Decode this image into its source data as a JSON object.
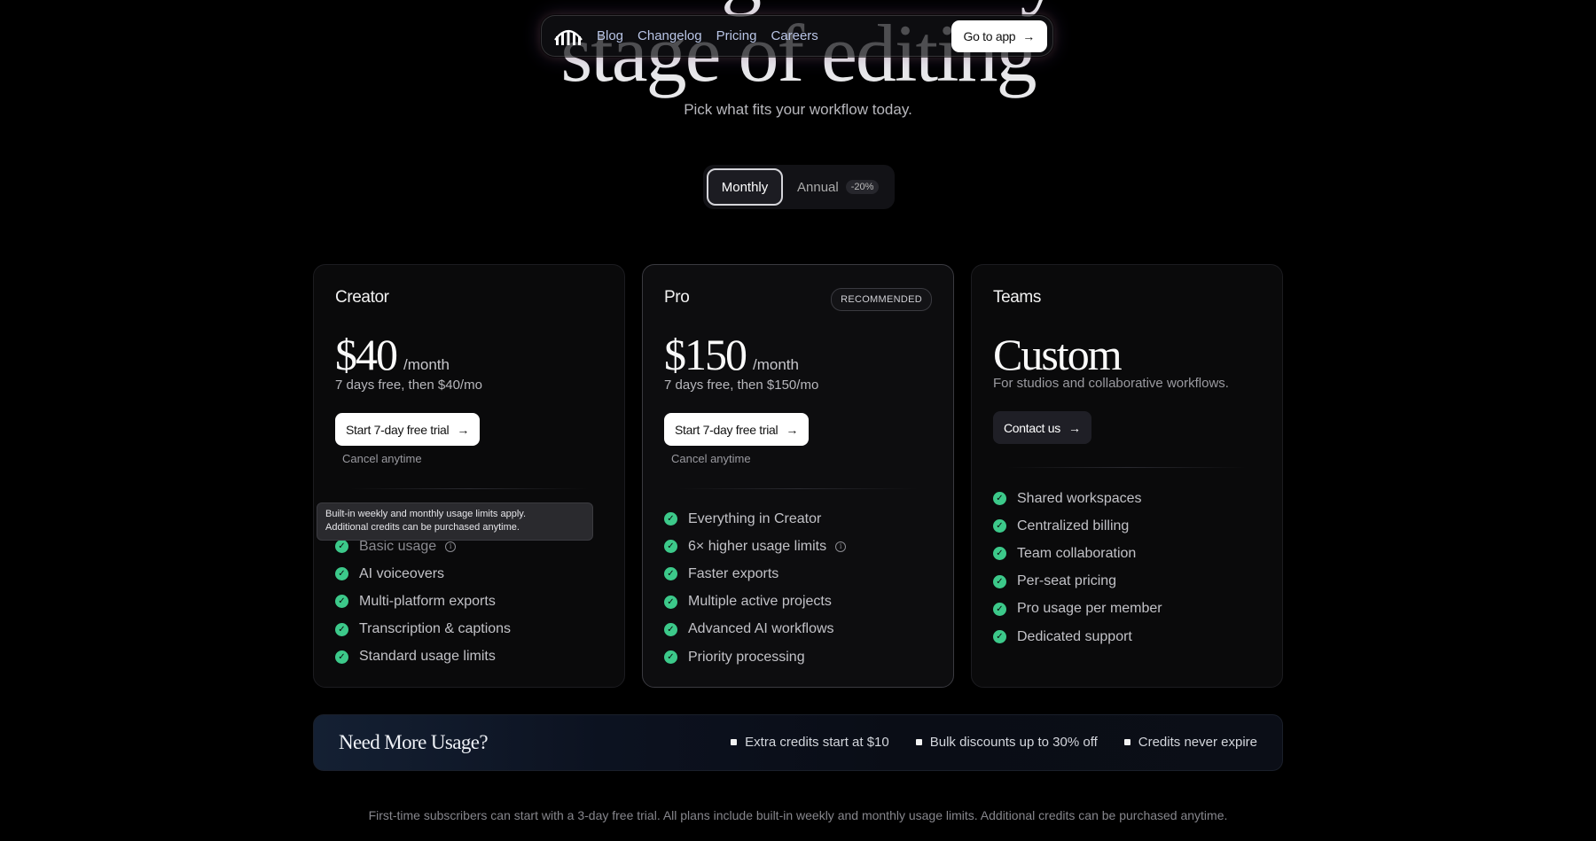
{
  "hero": {
    "line1": "Pricing for every",
    "line2": "stage of editing",
    "subtitle": "Pick what fits your workflow today."
  },
  "nav": {
    "links": [
      "Blog",
      "Changelog",
      "Pricing",
      "Careers"
    ],
    "cta": "Go to app"
  },
  "billing_toggle": {
    "monthly": "Monthly",
    "annual": "Annual",
    "discount": "-20%",
    "selected": "Monthly"
  },
  "plans": {
    "creator": {
      "name": "Creator",
      "price": "$40",
      "period": "/month",
      "note": "7 days free, then $40/mo",
      "cta": "Start 7-day free trial",
      "cancel": "Cancel anytime",
      "tooltip_line1": "Built-in weekly and monthly usage limits apply.",
      "tooltip_line2": "Additional credits can be purchased anytime.",
      "features": [
        "Basic usage",
        "AI voiceovers",
        "Multi-platform exports",
        "Transcription & captions",
        "Standard usage limits"
      ]
    },
    "pro": {
      "name": "Pro",
      "badge": "RECOMMENDED",
      "price": "$150",
      "period": "/month",
      "note": "7 days free, then $150/mo",
      "cta": "Start 7-day free trial",
      "cancel": "Cancel anytime",
      "features": [
        "Everything in Creator",
        "6× higher usage limits",
        "Faster exports",
        "Multiple active projects",
        "Advanced AI workflows",
        "Priority processing"
      ]
    },
    "teams": {
      "name": "Teams",
      "price": "Custom",
      "description": "For studios and collaborative workflows.",
      "cta": "Contact us",
      "features": [
        "Shared workspaces",
        "Centralized billing",
        "Team collaboration",
        "Per-seat pricing",
        "Pro usage per member",
        "Dedicated support"
      ]
    }
  },
  "usage": {
    "title": "Need More Usage?",
    "items": [
      "Extra credits start at $10",
      "Bulk discounts up to 30% off",
      "Credits never expire"
    ]
  },
  "footnote": "First-time subscribers can start with a 3-day free trial. All plans include built-in weekly and monthly usage limits. Additional credits can be purchased anytime.",
  "colors": {
    "background": "#000000",
    "check": "#3cc98a",
    "nav_link": "#b9c5e6"
  },
  "icons": {
    "logo": "logo-icon",
    "arrow": "arrow-right-icon",
    "check": "check-circle-icon",
    "info": "info-icon",
    "bullet": "square-bullet-icon"
  }
}
